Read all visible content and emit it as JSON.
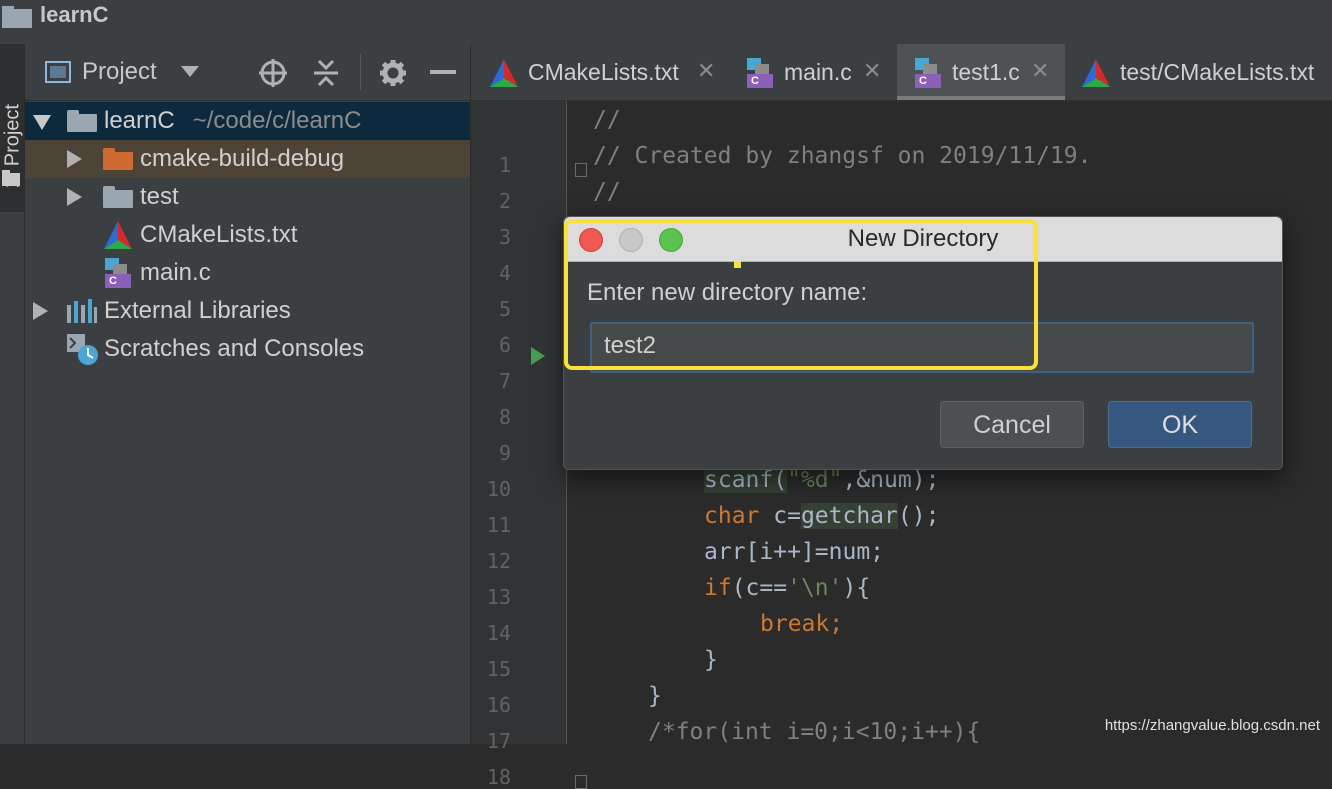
{
  "window": {
    "title": "learnC"
  },
  "sidestrip": {
    "tab_label": "1: Project"
  },
  "project_panel": {
    "header_label": "Project",
    "tree": [
      {
        "label": "learnC",
        "path": "~/code/c/learnC"
      },
      {
        "label": "cmake-build-debug"
      },
      {
        "label": "test"
      },
      {
        "label": "CMakeLists.txt"
      },
      {
        "label": "main.c"
      },
      {
        "label": "External Libraries"
      },
      {
        "label": "Scratches and Consoles"
      }
    ]
  },
  "editor_tabs": [
    {
      "label": "CMakeLists.txt"
    },
    {
      "label": "main.c"
    },
    {
      "label": "test1.c"
    },
    {
      "label": "test/CMakeLists.txt"
    }
  ],
  "line_numbers": [
    "1",
    "2",
    "3",
    "4",
    "5",
    "6",
    "7",
    "8",
    "9",
    "10",
    "11",
    "12",
    "13",
    "14",
    "15",
    "16",
    "17",
    "18"
  ],
  "code": {
    "l1": "//",
    "l2": "// Created by zhangsf on 2019/11/19.",
    "l3": "//",
    "l11a": "scanf(",
    "l11b": "\"%d\"",
    "l11c": ",&num);",
    "l12a": "char",
    "l12b": " c=",
    "l12c": "getchar",
    "l12d": "();",
    "l13": "arr[i++]=num;",
    "l14a": "if",
    "l14b": "(c==",
    "l14c": "'\\n'",
    "l14d": "){",
    "l15": "break;",
    "l16": "}",
    "l17": "}",
    "l18a": "/*",
    "l18b": "for",
    "l18c": "(int i=0;i<10;i++){"
  },
  "dialog": {
    "title": "New Directory",
    "prompt": "Enter new directory name:",
    "input_value": "test2",
    "cancel_label": "Cancel",
    "ok_label": "OK"
  },
  "watermark": "https://zhangvalue.blog.csdn.net",
  "colors": {
    "highlight": "#f7e13a",
    "close_light": "#ee5a52",
    "min_light": "#c8c8c8",
    "zoom_light": "#5bc24f"
  }
}
